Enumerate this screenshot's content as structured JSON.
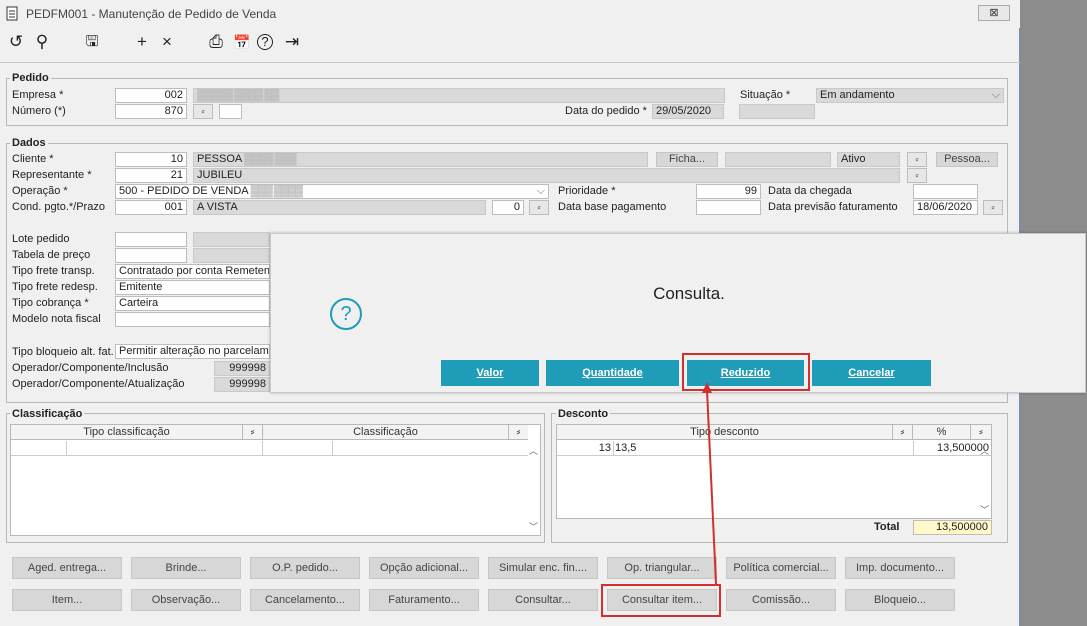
{
  "window": {
    "title": "PEDFM001 - Manutenção de Pedido de Venda",
    "close_label": "⊠"
  },
  "toolbar": {
    "refresh": "↺",
    "search": "⚲",
    "save": "🖫",
    "add": "+",
    "delete": "×",
    "print": "⎙",
    "calendar": "📅",
    "help": "?",
    "exit": "⇥"
  },
  "pedido": {
    "title": "Pedido",
    "empresa_label": "Empresa *",
    "empresa_value": "002",
    "empresa_name": "▓▓▓▓▓ ▓▓▓▓ ▓▓",
    "numero_label": "Número (*)",
    "numero_value": "870",
    "situacao_label": "Situação *",
    "situacao_value": "Em andamento",
    "data_label": "Data do pedido *",
    "data_value": "29/05/2020"
  },
  "dados": {
    "title": "Dados",
    "cliente_label": "Cliente *",
    "cliente_code": "10",
    "cliente_name": "PESSOA",
    "ficha_label": "Ficha...",
    "ativo_value": "Ativo",
    "pessoa_label": "Pessoa...",
    "representante_label": "Representante *",
    "representante_code": "21",
    "representante_name": "JUBILEU",
    "operacao_label": "Operação *",
    "operacao_value": "500 - PEDIDO DE VENDA",
    "prioridade_label": "Prioridade *",
    "prioridade_value": "99",
    "data_chegada_label": "Data da chegada",
    "cond_label": "Cond. pgto.*/Prazo",
    "cond_code": "001",
    "cond_name": "A VISTA",
    "prazo_value": "0",
    "data_base_label": "Data base pagamento",
    "data_prev_label": "Data previsão faturamento",
    "data_prev_value": "18/06/2020",
    "lote_label": "Lote pedido",
    "tabela_label": "Tabela de preço",
    "frete_transp_label": "Tipo frete transp.",
    "frete_transp_value": "Contratado por conta Remetent",
    "frete_redesp_label": "Tipo frete redesp.",
    "frete_redesp_value": "Emitente",
    "cobranca_label": "Tipo cobrança *",
    "cobranca_value": "Carteira",
    "modelo_label": "Modelo nota fiscal",
    "bloqueio_label": "Tipo bloqueio alt. fat.",
    "bloqueio_value": "Permitir alteração no parcelame",
    "op_inclusao_label": "Operador/Componente/Inclusão",
    "op_inclusao_value": "999998",
    "op_atualizacao_label": "Operador/Componente/Atualização",
    "op_atualizacao_value": "999998"
  },
  "classificacao": {
    "title": "Classificação",
    "headers": [
      "Tipo classificação",
      "Classificação"
    ]
  },
  "desconto": {
    "title": "Desconto",
    "headers": [
      "Tipo desconto",
      "%"
    ],
    "rows": [
      {
        "code": "13",
        "name": "13,5",
        "pct": "13,500000"
      }
    ],
    "total_label": "Total",
    "total_value": "13,500000"
  },
  "buttons_row1": [
    "Aged. entrega...",
    "Brinde...",
    "O.P. pedido...",
    "Opção adicional...",
    "Simular enc. fin....",
    "Op. triangular...",
    "Política comercial...",
    "Imp. documento..."
  ],
  "buttons_row2": [
    "Item...",
    "Observação...",
    "Cancelamento...",
    "Faturamento...",
    "Consultar...",
    "Consultar item...",
    "Comissão...",
    "Bloqueio..."
  ],
  "dialog": {
    "message": "Consulta.",
    "icon": "?",
    "buttons": [
      "Valor",
      "Quantidade",
      "Reduzido",
      "Cancelar"
    ],
    "colors": {
      "button": "#1e9cb8",
      "highlight": "#d32f2f"
    }
  }
}
